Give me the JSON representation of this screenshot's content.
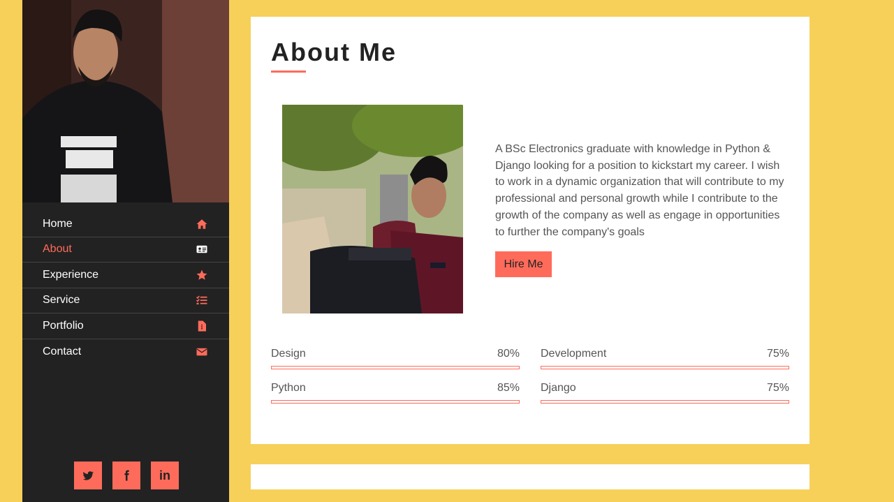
{
  "sidebar": {
    "nav": [
      {
        "label": "Home",
        "icon": "home-icon"
      },
      {
        "label": "About",
        "icon": "id-card-icon",
        "active": true
      },
      {
        "label": "Experience",
        "icon": "star-icon"
      },
      {
        "label": "Service",
        "icon": "list-check-icon"
      },
      {
        "label": "Portfolio",
        "icon": "file-icon"
      },
      {
        "label": "Contact",
        "icon": "envelope-icon"
      }
    ],
    "social": [
      {
        "name": "twitter-icon"
      },
      {
        "name": "facebook-icon"
      },
      {
        "name": "linkedin-icon",
        "text": "in"
      }
    ]
  },
  "about": {
    "title": "About Me",
    "description": "A BSc Electronics graduate with knowledge in Python & Django looking for a position to kickstart my career. I wish to work in a dynamic organization that will contribute to my professional and personal growth while I contribute to the growth of the company as well as engage in opportunities to further the company's goals",
    "hire_label": "Hire Me"
  },
  "skills": [
    {
      "name": "Design",
      "percent": "80%",
      "level": 0.8
    },
    {
      "name": "Development",
      "percent": "75%",
      "level": 0.75
    },
    {
      "name": "Python",
      "percent": "85%",
      "level": 0.85
    },
    {
      "name": "Django",
      "percent": "75%",
      "level": 0.75
    }
  ],
  "colors": {
    "accent": "#ff6b5b",
    "background": "#f7d05a",
    "sidebar": "#222222"
  }
}
